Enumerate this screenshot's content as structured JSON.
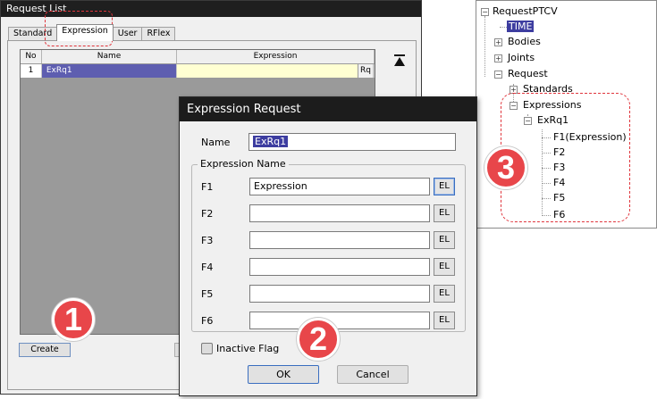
{
  "request_list": {
    "title": "Request List",
    "tabs": [
      "Standard",
      "Expression",
      "User",
      "RFlex"
    ],
    "active_tab": "Expression",
    "columns": [
      "No",
      "Name",
      "Expression"
    ],
    "rows": [
      {
        "no": "1",
        "name": "ExRq1",
        "expression": ""
      }
    ],
    "rq_label": "Rq",
    "create_label": "Create"
  },
  "tree": {
    "root": "RequestPTCV",
    "nodes": {
      "time": "TIME",
      "bodies": "Bodies",
      "joints": "Joints",
      "request": "Request",
      "standards": "Standards",
      "expressions": "Expressions",
      "exrq1": "ExRq1",
      "f1": "F1(Expression)",
      "f2": "F2",
      "f3": "F3",
      "f4": "F4",
      "f5": "F5",
      "f6": "F6"
    }
  },
  "dialog": {
    "title": "Expression Request",
    "name_label": "Name",
    "name_value": "ExRq1",
    "group_title": "Expression Name",
    "fields": [
      {
        "label": "F1",
        "value": "Expression",
        "btn": "EL"
      },
      {
        "label": "F2",
        "value": "",
        "btn": "EL"
      },
      {
        "label": "F3",
        "value": "",
        "btn": "EL"
      },
      {
        "label": "F4",
        "value": "",
        "btn": "EL"
      },
      {
        "label": "F5",
        "value": "",
        "btn": "EL"
      },
      {
        "label": "F6",
        "value": "",
        "btn": "EL"
      }
    ],
    "inactive_flag_label": "Inactive Flag",
    "ok_label": "OK",
    "cancel_label": "Cancel"
  },
  "badges": [
    "1",
    "2",
    "3"
  ],
  "colors": {
    "badge": "#e8464a",
    "highlight": "#e0353c",
    "selection": "#3d3da0"
  }
}
